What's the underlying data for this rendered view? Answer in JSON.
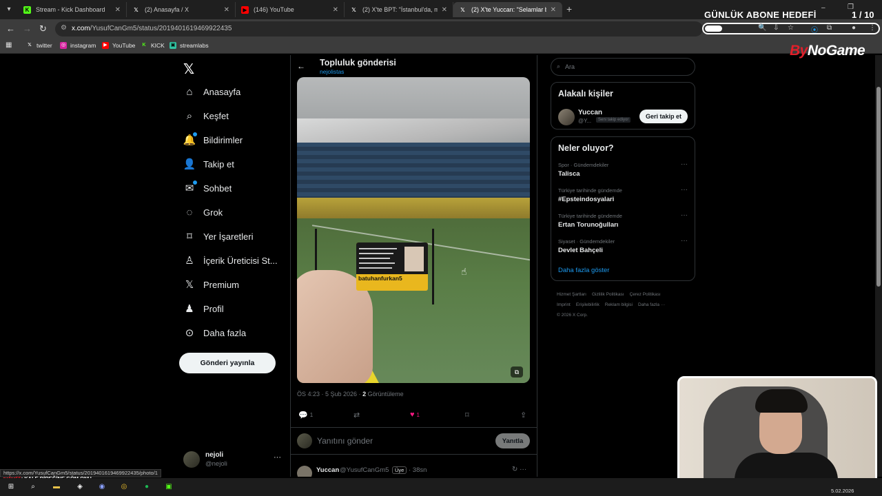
{
  "browser": {
    "tabs": [
      {
        "title": "Stream - Kick Dashboard",
        "icon": "kick-icon",
        "color": "#53fc18",
        "active": false
      },
      {
        "title": "(2) Anasayfa / X",
        "icon": "x-icon",
        "color": "#ffffff",
        "active": false
      },
      {
        "title": "(146) YouTube",
        "icon": "youtube-icon",
        "color": "#ff0000",
        "active": false
      },
      {
        "title": "(2) X'te BPT: \"İstanbul'da, madd",
        "icon": "x-icon",
        "color": "#ffffff",
        "active": false
      },
      {
        "title": "(2) X'te Yuccan: \"Selamlar bugü",
        "icon": "x-icon",
        "color": "#ffffff",
        "active": true
      }
    ],
    "address": {
      "domain": "x.com",
      "path": "/YusufCanGm5/status/2019401619469922435"
    },
    "bookmarks": [
      {
        "label": "twitter",
        "icon": "x-icon"
      },
      {
        "label": "instagram",
        "icon": "instagram-icon"
      },
      {
        "label": "YouTube",
        "icon": "youtube-icon"
      },
      {
        "label": "KICK",
        "icon": "kick-icon"
      },
      {
        "label": "streamlabs",
        "icon": "streamlabs-icon"
      }
    ],
    "status_url": "https://x.com/YusufCanGm5/status/2019401619469922435/photo/1"
  },
  "overlay": {
    "goal_title": "GÜNLÜK ABONE HEDEFİ",
    "goal_count": "1 / 10",
    "goal_progress": 0.1,
    "brand": {
      "prefix": "By",
      "name": "NoGame"
    },
    "ticker_user": "gafer55",
    "ticker_text": ": KALE DİREĞİNE GÖM ONU"
  },
  "nav": {
    "items": [
      {
        "label": "Anasayfa",
        "icon": "home-icon",
        "dot": false
      },
      {
        "label": "Keşfet",
        "icon": "search-icon",
        "dot": false
      },
      {
        "label": "Bildirimler",
        "icon": "bell-icon",
        "dot": true
      },
      {
        "label": "Takip et",
        "icon": "add-user-icon",
        "dot": false
      },
      {
        "label": "Sohbet",
        "icon": "mail-icon",
        "dot": true
      },
      {
        "label": "Grok",
        "icon": "grok-icon",
        "dot": false
      },
      {
        "label": "Yer İşaretleri",
        "icon": "bookmark-icon",
        "dot": false
      },
      {
        "label": "İçerik Üreticisi St...",
        "icon": "creator-icon",
        "dot": false
      },
      {
        "label": "Premium",
        "icon": "x-icon",
        "dot": false
      },
      {
        "label": "Profil",
        "icon": "profile-icon",
        "dot": false
      },
      {
        "label": "Daha fazla",
        "icon": "more-circle-icon",
        "dot": false
      }
    ],
    "post_button": "Gönderi yayınla",
    "account": {
      "name": "nejoli",
      "handle": "@nejoli",
      "more": "···"
    }
  },
  "post": {
    "title": "Topluluk gönderisi",
    "subtitle": "nejolistas",
    "card_name": "batuhanfurkan5",
    "time": "ÖS 4:23 · 5 Şub 2026 · ",
    "views_count": "2",
    "views_label": " Görüntüleme",
    "reply_count": "1",
    "like_count": "1",
    "reply_placeholder": "Yanıtını gönder",
    "reply_button": "Yanıtla"
  },
  "reply": {
    "name": "Yuccan",
    "handle": "@YusufCanGm5",
    "tag": "Üye",
    "time": "· 38sn"
  },
  "right": {
    "search_placeholder": "Ara",
    "related_title": "Alakalı kişiler",
    "person": {
      "name": "Yuccan",
      "handle": "@Y...",
      "tag": "Seni takip ediyor",
      "button": "Geri takip et"
    },
    "trends_title": "Neler oluyor?",
    "trends": [
      {
        "category": "Spor · Gündemdekiler",
        "title": "Talisca"
      },
      {
        "category": "Türkiye tarihinde gündemde",
        "title": "#Epsteindosyalari"
      },
      {
        "category": "Türkiye tarihinde gündemde",
        "title": "Ertan Torunoğulları"
      },
      {
        "category": "Siyaset · Gündemdekiler",
        "title": "Devlet Bahçeli"
      }
    ],
    "show_more": "Daha fazla göster",
    "footer": [
      "Hizmet Şartları",
      "Gizlilik Politikası",
      "Çerez Politikası",
      "Imprint",
      "Erişilebilirlik",
      "Reklam bilgisi",
      "Daha fazla ···",
      "© 2026 X Corp."
    ]
  },
  "taskbar": {
    "date": "5.02.2026"
  }
}
